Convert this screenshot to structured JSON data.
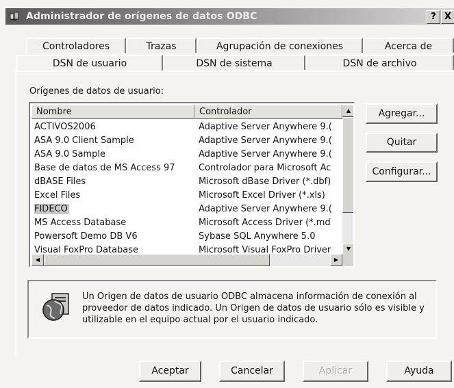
{
  "window": {
    "title": "Administrador de orígenes de datos ODBC",
    "help_glyph": "?",
    "close_glyph": "X"
  },
  "tabs_back": [
    {
      "label": "Controladores"
    },
    {
      "label": "Trazas"
    },
    {
      "label": "Agrupación de conexiones"
    },
    {
      "label": "Acerca de"
    }
  ],
  "tabs_front": [
    {
      "label": "DSN de usuario",
      "active": true
    },
    {
      "label": "DSN de sistema",
      "active": false
    },
    {
      "label": "DSN de archivo",
      "active": false
    }
  ],
  "list": {
    "caption": "Orígenes de datos de usuario:",
    "columns": [
      "Nombre",
      "Controlador"
    ],
    "rows": [
      {
        "name": "ACTIVOS2006",
        "driver": "Adaptive Server Anywhere 9.("
      },
      {
        "name": "ASA 9.0 Client Sample",
        "driver": "Adaptive Server Anywhere 9.("
      },
      {
        "name": "ASA 9.0 Sample",
        "driver": "Adaptive Server Anywhere 9.("
      },
      {
        "name": "Base de datos de MS Access 97",
        "driver": "Controlador para Microsoft Ac"
      },
      {
        "name": "dBASE Files",
        "driver": "Microsoft dBase Driver (*.dbf)"
      },
      {
        "name": "Excel Files",
        "driver": "Microsoft Excel Driver (*.xls)"
      },
      {
        "name": "FIDECO",
        "driver": "Adaptive Server Anywhere 9.(",
        "selected": true
      },
      {
        "name": "MS Access Database",
        "driver": "Microsoft Access Driver (*.md"
      },
      {
        "name": "Powersoft Demo DB V6",
        "driver": "Sybase SQL Anywhere 5.0"
      },
      {
        "name": "Visual FoxPro Database",
        "driver": "Microsoft Visual FoxPro Driver"
      }
    ]
  },
  "side_buttons": {
    "add": "Agregar...",
    "remove": "Quitar",
    "configure": "Configurar..."
  },
  "info": {
    "text": "Un Origen de datos de usuario ODBC almacena información de conexión al proveedor de datos indicado. Un Origen de datos de usuario sólo es visible y utilizable en el equipo actual por el usuario indicado."
  },
  "footer": {
    "ok": "Aceptar",
    "cancel": "Cancelar",
    "apply": "Aplicar",
    "help": "Ayuda"
  }
}
